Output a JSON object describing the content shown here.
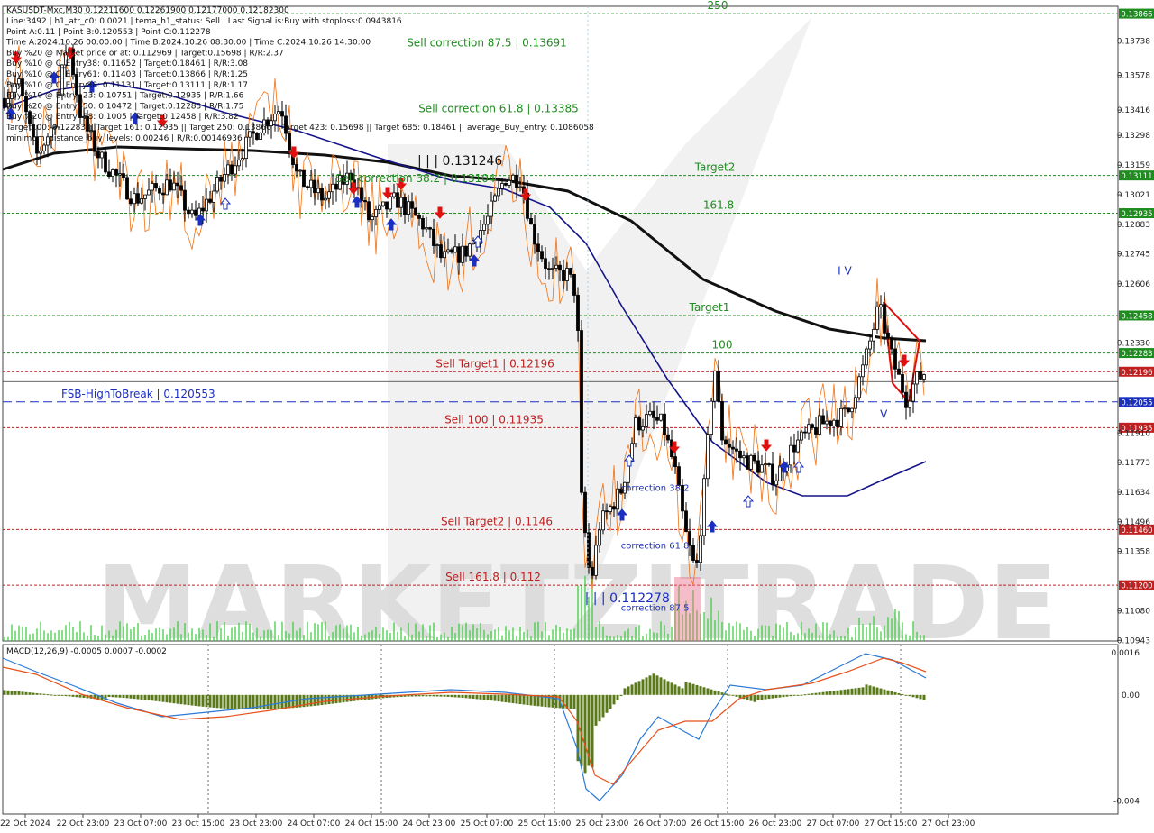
{
  "chart_data": [
    {
      "type": "candlestick",
      "symbol_header": "KASUSDT-Mxc,M30  0.12211600 0.12261900 0.12177000 0.12182300",
      "info_lines": [
        "Line:3492 | h1_atr_c0: 0.0021 | tema_h1_status: Sell | Last Signal is:Buy with stoploss:0.0943816",
        "Point A:0.11 | Point B:0.120553 | Point C:0.112278",
        "Time A:2024.10.26 00:00:00 | Time B:2024.10.26 08:30:00 | Time C:2024.10.26 14:30:00",
        "Buy %20 @ Market price or at: 0.112969 | Target:0.15698 | R/R:2.37",
        "Buy %10 @ C_Entry38: 0.11652 | Target:0.18461 | R/R:3.08",
        "Buy %10 @ C_Entry61: 0.11403 | Target:0.13866 | R/R:1.25",
        "Buy %10 @ C_Entry88: 0.11131 | Target:0.13111 | R/R:1.17",
        "Buy %10 @ Entry -23: 0.10751 | Target:0.12935 | R/R:1.66",
        "Buy %20 @ Entry -50: 0.10472 | Target:0.12283 | R/R:1.75",
        "Buy %20 @ Entry -88: 0.1005 | Target:0.12458 | R/R:3.82",
        "Target100: 0.12283 || Target 161: 0.12935 || Target 250: 0.13866 || Target 423: 0.15698 || Target 685: 0.18461 || average_Buy_entry: 0.1086058",
        "minimum_distance_buy_levels: 0.00246 | R/R:0.00146936"
      ],
      "price_ticks": [
        "0.13738",
        "0.13578",
        "0.13416",
        "0.13298",
        "0.13159",
        "0.13021",
        "0.12883",
        "0.12745",
        "0.12606",
        "0.12330",
        "0.11910",
        "0.11773",
        "0.11634",
        "0.11496",
        "0.11358",
        "0.11080",
        "0.10943"
      ],
      "time_ticks": [
        "22 Oct 2024",
        "22 Oct 23:00",
        "23 Oct 07:00",
        "23 Oct 15:00",
        "23 Oct 23:00",
        "24 Oct 07:00",
        "24 Oct 15:00",
        "24 Oct 23:00",
        "25 Oct 07:00",
        "25 Oct 15:00",
        "25 Oct 23:00",
        "26 Oct 07:00",
        "26 Oct 15:00",
        "26 Oct 23:00",
        "27 Oct 07:00",
        "27 Oct 15:00",
        "27 Oct 23:00"
      ],
      "y_range": [
        0.1094,
        0.139
      ],
      "levels": [
        {
          "price": 0.13866,
          "label": "250",
          "badge": "0.13866",
          "color": "#1f8c1f",
          "style": "dashed"
        },
        {
          "price": 0.13691,
          "label": "Sell correction 87.5 | 0.13691",
          "badge": "",
          "color": "#1f8c1f",
          "style": "none"
        },
        {
          "price": 0.13385,
          "label": "Sell correction 61.8 | 0.13385",
          "badge": "",
          "color": "#1f8c1f",
          "style": "none"
        },
        {
          "price": 0.13111,
          "label": "Target2",
          "badge": "0.13111",
          "color": "#1f8c1f",
          "style": "dashed"
        },
        {
          "price": 0.12935,
          "label": "161.8",
          "badge": "0.12935",
          "color": "#1f8c1f",
          "style": "dashed"
        },
        {
          "price": 0.12458,
          "label": "Target1",
          "badge": "0.12458",
          "color": "#1f8c1f",
          "style": "dashed"
        },
        {
          "price": 0.12283,
          "label": "100",
          "badge": "0.12283",
          "color": "#1f8c1f",
          "style": "dashed"
        },
        {
          "price": 0.12196,
          "label": "Sell Target1 | 0.12196",
          "badge": "0.12196",
          "color": "#c02020",
          "style": "dashed"
        },
        {
          "price": 0.12055,
          "label": "FSB-HighToBreak | 0.120553",
          "badge": "0.12055",
          "color": "#1a2fc0",
          "style": "longdash"
        },
        {
          "price": 0.11935,
          "label": "Sell 100 | 0.11935",
          "badge": "0.11935",
          "color": "#c02020",
          "style": "dashed"
        },
        {
          "price": 0.1146,
          "label": "Sell Target2 | 0.1146",
          "badge": "0.11460",
          "color": "#c02020",
          "style": "dashed"
        },
        {
          "price": 0.112,
          "label": "Sell 161.8 | 0.112",
          "badge": "0.11200",
          "color": "#c02020",
          "style": "dashed"
        }
      ],
      "annotations": [
        {
          "text": "| | | 0.131246",
          "price": 0.1316,
          "time_index": 0.41,
          "color": "#111"
        },
        {
          "text": "Sell correction 38.2 | 0.13104",
          "price": 0.1308,
          "time_index": 0.37,
          "color": "#1f8c1f"
        },
        {
          "text": "| | | 0.112278",
          "price": 0.1112,
          "time_index": 0.56,
          "color": "#1a2fc0"
        },
        {
          "text": "correction 38.2",
          "price": 0.1164,
          "time_index": 0.585,
          "color": "#1a2fc0"
        },
        {
          "text": "correction 61.8",
          "price": 0.1137,
          "time_index": 0.585,
          "color": "#1a2fc0"
        },
        {
          "text": "correction 87.5",
          "price": 0.1108,
          "time_index": 0.585,
          "color": "#1a2fc0"
        },
        {
          "text": "I V",
          "price": 0.1265,
          "time_index": 0.755,
          "color": "#1a2fc0"
        },
        {
          "text": "V",
          "price": 0.1198,
          "time_index": 0.79,
          "color": "#1a2fc0"
        }
      ],
      "watermark": "MARKETZITRADE",
      "macd": {
        "label": "MACD(12,26,9) -0.0005 0.0007 -0.0002",
        "ticks": [
          "0.0016",
          "0.00",
          "-0.004"
        ],
        "range": [
          -0.0045,
          0.0019
        ]
      },
      "grid": false,
      "legend": "none"
    }
  ]
}
